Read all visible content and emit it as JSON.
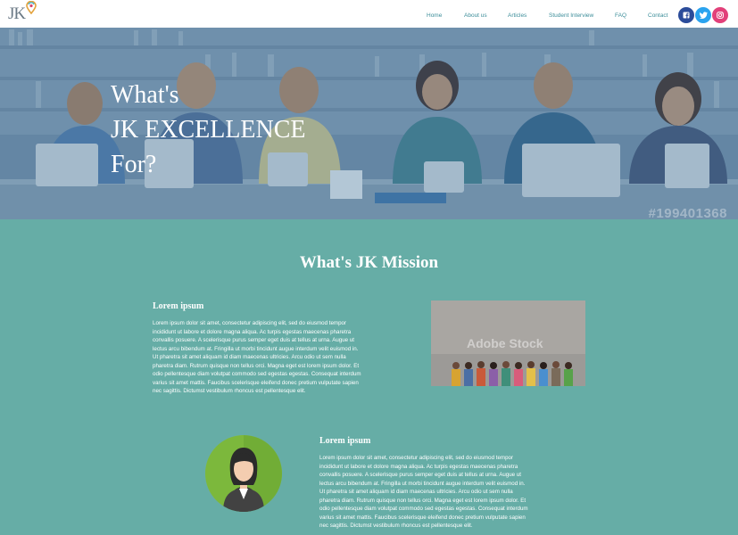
{
  "logo": {
    "text": "JK",
    "icon": "location-pin-icon"
  },
  "nav": {
    "items": [
      {
        "label": "Home"
      },
      {
        "label": "About us"
      },
      {
        "label": "Articles"
      },
      {
        "label": "Student Interview"
      },
      {
        "label": "FAQ"
      },
      {
        "label": "Contact"
      }
    ]
  },
  "social": [
    {
      "icon": "facebook-icon",
      "color": "#3b5998"
    },
    {
      "icon": "twitter-icon",
      "color": "#1da1f2"
    },
    {
      "icon": "instagram-icon",
      "color": "#e1306c"
    }
  ],
  "hero": {
    "line1": "What's",
    "line2": "JK EXCELLENCE",
    "line3": "For?",
    "watermark": "#199401368"
  },
  "mission": {
    "title": "What's JK Mission",
    "block1": {
      "heading": "Lorem ipsum",
      "text": "Lorem ipsum dolor sit amet, consectetur adipiscing elit, sed do eiusmod tempor incididunt ut labore et dolore magna aliqua. Ac turpis egestas maecenas pharetra convallis posuere. A scelerisque purus semper eget duis at tellus at urna. Augue ut lectus arcu bibendum at. Fringilla ut morbi tincidunt augue interdum velit euismod in. Ut pharetra sit amet aliquam id diam maecenas ultricies. Arcu odio ut sem nulla pharetra diam. Rutrum quisque non tellus orci. Magna eget est lorem ipsum dolor. Et odio pellentesque diam volutpat commodo sed egestas egestas. Consequat interdum varius sit amet mattis. Faucibus scelerisque eleifend donec pretium vulputate sapien nec sagittis. Dictumst vestibulum rhoncus est pellentesque elit.",
      "image_watermark": "Adobe Stock"
    },
    "block2": {
      "heading": "Lorem ipsum",
      "text": "Lorem ipsum dolor sit amet, consectetur adipiscing elit, sed do eiusmod tempor incididunt ut labore et dolore magna aliqua. Ac turpis egestas maecenas pharetra convallis posuere. A scelerisque purus semper eget duis at tellus at urna. Augue ut lectus arcu bibendum at. Fringilla ut morbi tincidunt augue interdum velit euismod in. Ut pharetra sit amet aliquam id diam maecenas ultricies. Arcu odio ut sem nulla pharetra diam. Rutrum quisque non tellus orci. Magna eget est lorem ipsum dolor. Et odio pellentesque diam volutpat commodo sed egestas egestas. Consequat interdum varius sit amet mattis. Faucibus scelerisque eleifend donec pretium vulputate sapien nec sagittis. Dictumst vestibulum rhoncus est pellentesque elit."
    }
  },
  "colors": {
    "background": "#66ada6",
    "nav_text": "#3d8e9a",
    "hero_overlay": "#5b7e9e"
  }
}
